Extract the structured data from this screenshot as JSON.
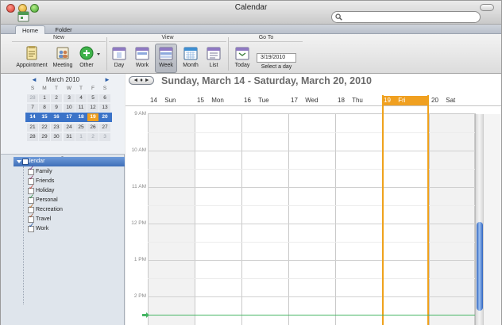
{
  "window": {
    "title": "Calendar"
  },
  "search": {
    "placeholder": ""
  },
  "tabs": [
    {
      "label": "Home"
    },
    {
      "label": "Folder"
    }
  ],
  "ribbon": {
    "groups": {
      "new": "New",
      "view": "View",
      "goto": "Go To"
    },
    "buttons": {
      "appointment": "Appointment",
      "meeting": "Meeting",
      "other": "Other",
      "day": "Day",
      "work": "Work",
      "week": "Week",
      "month": "Month",
      "list": "List",
      "today": "Today"
    },
    "goto_date": "3/19/2010",
    "select_day": "Select a day"
  },
  "mini_calendar": {
    "month_label": "March 2010",
    "prev": "◄",
    "next": "►",
    "weekdays": [
      "S",
      "M",
      "T",
      "W",
      "T",
      "F",
      "S"
    ],
    "weeks": [
      [
        "28",
        "1",
        "2",
        "3",
        "4",
        "5",
        "6"
      ],
      [
        "7",
        "8",
        "9",
        "10",
        "11",
        "12",
        "13"
      ],
      [
        "14",
        "15",
        "16",
        "17",
        "18",
        "19",
        "20"
      ],
      [
        "21",
        "22",
        "23",
        "24",
        "25",
        "26",
        "27"
      ],
      [
        "28",
        "29",
        "30",
        "31",
        "1",
        "2",
        "3"
      ]
    ]
  },
  "calendars": {
    "header": "Calendar",
    "items": [
      {
        "name": "Family",
        "color": "#6b2a7a"
      },
      {
        "name": "Friends",
        "color": "#8a2a55"
      },
      {
        "name": "Holiday",
        "color": "#c0392b"
      },
      {
        "name": "Personal",
        "color": "#2e8b3e"
      },
      {
        "name": "Recreation",
        "color": "#b5651d"
      },
      {
        "name": "Travel",
        "color": "#a0522d"
      },
      {
        "name": "Work",
        "color": "#1f4f9a"
      }
    ]
  },
  "week_view": {
    "range_nav": "◄ ♦ ►",
    "range_title": "Sunday, March 14 - Saturday, March 20, 2010",
    "days": [
      {
        "num": "14",
        "name": "Sun"
      },
      {
        "num": "15",
        "name": "Mon"
      },
      {
        "num": "16",
        "name": "Tue"
      },
      {
        "num": "17",
        "name": "Wed"
      },
      {
        "num": "18",
        "name": "Thu"
      },
      {
        "num": "19",
        "name": "Fri"
      },
      {
        "num": "20",
        "name": "Sat"
      }
    ],
    "hours": [
      "9 AM",
      "10 AM",
      "11 AM",
      "12 PM",
      "1 PM",
      "2 PM"
    ],
    "selected_day": "19"
  },
  "colors": {
    "accent": "#3b73c8",
    "today": "#f0a020",
    "now_line": "#46b563"
  }
}
